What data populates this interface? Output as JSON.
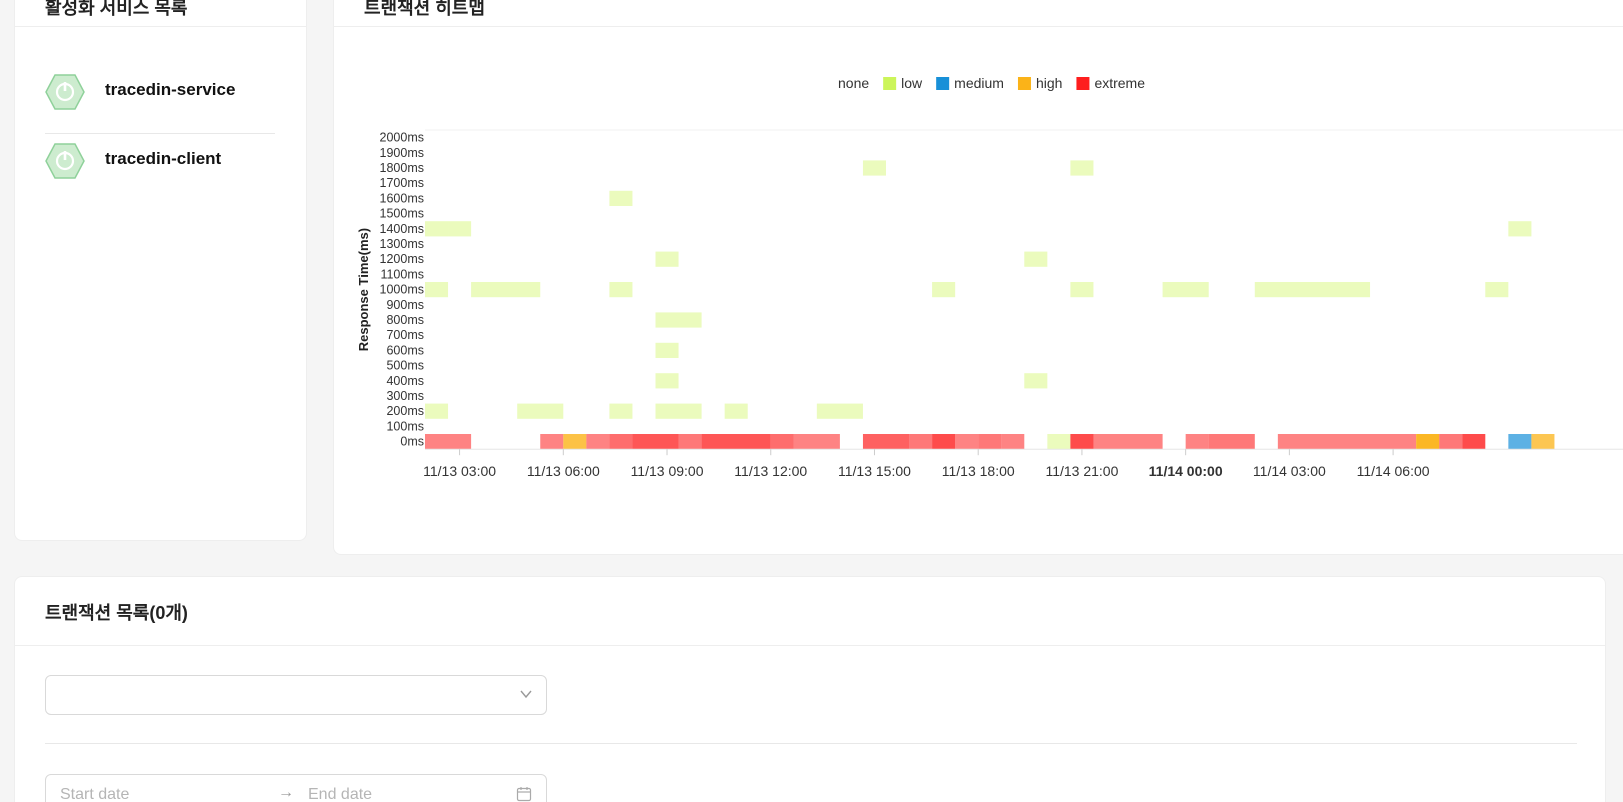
{
  "services_card": {
    "title": "활성화 서비스 목록",
    "items": [
      {
        "name": "tracedin-service",
        "icon": "power-hex-icon"
      },
      {
        "name": "tracedin-client",
        "icon": "power-hex-icon"
      }
    ]
  },
  "heatmap_card": {
    "title": "트랜잭션 히트맵"
  },
  "transactions_card": {
    "title": "트랜잭션 목록(0개)",
    "select": {
      "value": ""
    },
    "date_range": {
      "start_placeholder": "Start date",
      "end_placeholder": "End date",
      "separator": "→"
    }
  },
  "colors": {
    "low": "#ccf55a",
    "medium": "#1890d8",
    "high": "#fbb318",
    "extreme": "#fe1e1e"
  },
  "chart_data": {
    "type": "heatmap",
    "ylabel": "Response Time(ms)",
    "legend": [
      "none",
      "low",
      "medium",
      "high",
      "extreme"
    ],
    "legend_position": "top",
    "y_categories": [
      "0ms",
      "100ms",
      "200ms",
      "300ms",
      "400ms",
      "500ms",
      "600ms",
      "700ms",
      "800ms",
      "900ms",
      "1000ms",
      "1100ms",
      "1200ms",
      "1300ms",
      "1400ms",
      "1500ms",
      "1600ms",
      "1700ms",
      "1800ms",
      "1900ms",
      "2000ms"
    ],
    "x_ticks": [
      {
        "label": "11/13 03:00",
        "bold": false
      },
      {
        "label": "11/13 06:00",
        "bold": false
      },
      {
        "label": "11/13 09:00",
        "bold": false
      },
      {
        "label": "11/13 12:00",
        "bold": false
      },
      {
        "label": "11/13 15:00",
        "bold": false
      },
      {
        "label": "11/13 18:00",
        "bold": false
      },
      {
        "label": "11/13 21:00",
        "bold": false
      },
      {
        "label": "11/14 00:00",
        "bold": true
      },
      {
        "label": "11/14 03:00",
        "bold": false
      },
      {
        "label": "11/14 06:00",
        "bold": false
      }
    ],
    "x_start": "11/13 02:00",
    "bin_minutes": 40,
    "cells": [
      {
        "x_bin": 0,
        "w": 1,
        "y": "1400ms",
        "level": "low",
        "alpha": 0.4
      },
      {
        "x_bin": 1,
        "w": 1,
        "y": "1400ms",
        "level": "low",
        "alpha": 0.4
      },
      {
        "x_bin": 0,
        "w": 1,
        "y": "1000ms",
        "level": "low",
        "alpha": 0.4
      },
      {
        "x_bin": 2,
        "w": 3,
        "y": "1000ms",
        "level": "low",
        "alpha": 0.4
      },
      {
        "x_bin": 0,
        "w": 1,
        "y": "200ms",
        "level": "low",
        "alpha": 0.4
      },
      {
        "x_bin": 4,
        "w": 2,
        "y": "200ms",
        "level": "low",
        "alpha": 0.4
      },
      {
        "x_bin": 8,
        "w": 1,
        "y": "1600ms",
        "level": "low",
        "alpha": 0.4
      },
      {
        "x_bin": 8,
        "w": 1,
        "y": "1000ms",
        "level": "low",
        "alpha": 0.4
      },
      {
        "x_bin": 8,
        "w": 1,
        "y": "200ms",
        "level": "low",
        "alpha": 0.4
      },
      {
        "x_bin": 10,
        "w": 1,
        "y": "1200ms",
        "level": "low",
        "alpha": 0.4
      },
      {
        "x_bin": 10,
        "w": 2,
        "y": "800ms",
        "level": "low",
        "alpha": 0.4
      },
      {
        "x_bin": 10,
        "w": 1,
        "y": "600ms",
        "level": "low",
        "alpha": 0.4
      },
      {
        "x_bin": 10,
        "w": 1,
        "y": "400ms",
        "level": "low",
        "alpha": 0.4
      },
      {
        "x_bin": 10,
        "w": 2,
        "y": "200ms",
        "level": "low",
        "alpha": 0.4
      },
      {
        "x_bin": 13,
        "w": 1,
        "y": "200ms",
        "level": "low",
        "alpha": 0.4
      },
      {
        "x_bin": 17,
        "w": 2,
        "y": "200ms",
        "level": "low",
        "alpha": 0.4
      },
      {
        "x_bin": 19,
        "w": 1,
        "y": "1800ms",
        "level": "low",
        "alpha": 0.4
      },
      {
        "x_bin": 22,
        "w": 1,
        "y": "1000ms",
        "level": "low",
        "alpha": 0.4
      },
      {
        "x_bin": 26,
        "w": 1,
        "y": "1200ms",
        "level": "low",
        "alpha": 0.4
      },
      {
        "x_bin": 26,
        "w": 1,
        "y": "400ms",
        "level": "low",
        "alpha": 0.4
      },
      {
        "x_bin": 28,
        "w": 1,
        "y": "1800ms",
        "level": "low",
        "alpha": 0.4
      },
      {
        "x_bin": 28,
        "w": 1,
        "y": "1000ms",
        "level": "low",
        "alpha": 0.4
      },
      {
        "x_bin": 32,
        "w": 2,
        "y": "1000ms",
        "level": "low",
        "alpha": 0.4
      },
      {
        "x_bin": 36,
        "w": 5,
        "y": "1000ms",
        "level": "low",
        "alpha": 0.4
      },
      {
        "x_bin": 46,
        "w": 1,
        "y": "1000ms",
        "level": "low",
        "alpha": 0.4
      },
      {
        "x_bin": 47,
        "w": 1,
        "y": "1400ms",
        "level": "low",
        "alpha": 0.4
      },
      {
        "x_bin": 0,
        "w": 2,
        "y": "0ms",
        "level": "extreme",
        "alpha": 0.55
      },
      {
        "x_bin": 5,
        "w": 1,
        "y": "0ms",
        "level": "extreme",
        "alpha": 0.55
      },
      {
        "x_bin": 6,
        "w": 1,
        "y": "0ms",
        "level": "high",
        "alpha": 0.8
      },
      {
        "x_bin": 7,
        "w": 1,
        "y": "0ms",
        "level": "extreme",
        "alpha": 0.55
      },
      {
        "x_bin": 8,
        "w": 1,
        "y": "0ms",
        "level": "extreme",
        "alpha": 0.65
      },
      {
        "x_bin": 9,
        "w": 2,
        "y": "0ms",
        "level": "extreme",
        "alpha": 0.75
      },
      {
        "x_bin": 11,
        "w": 1,
        "y": "0ms",
        "level": "extreme",
        "alpha": 0.6
      },
      {
        "x_bin": 12,
        "w": 3,
        "y": "0ms",
        "level": "extreme",
        "alpha": 0.75
      },
      {
        "x_bin": 15,
        "w": 1,
        "y": "0ms",
        "level": "extreme",
        "alpha": 0.65
      },
      {
        "x_bin": 16,
        "w": 2,
        "y": "0ms",
        "level": "extreme",
        "alpha": 0.55
      },
      {
        "x_bin": 19,
        "w": 2,
        "y": "0ms",
        "level": "extreme",
        "alpha": 0.7
      },
      {
        "x_bin": 21,
        "w": 1,
        "y": "0ms",
        "level": "extreme",
        "alpha": 0.6
      },
      {
        "x_bin": 22,
        "w": 1,
        "y": "0ms",
        "level": "extreme",
        "alpha": 0.8
      },
      {
        "x_bin": 23,
        "w": 1,
        "y": "0ms",
        "level": "extreme",
        "alpha": 0.55
      },
      {
        "x_bin": 24,
        "w": 1,
        "y": "0ms",
        "level": "extreme",
        "alpha": 0.6
      },
      {
        "x_bin": 25,
        "w": 1,
        "y": "0ms",
        "level": "extreme",
        "alpha": 0.55
      },
      {
        "x_bin": 27,
        "w": 1,
        "y": "0ms",
        "level": "low",
        "alpha": 0.4
      },
      {
        "x_bin": 28,
        "w": 1,
        "y": "0ms",
        "level": "extreme",
        "alpha": 0.8
      },
      {
        "x_bin": 29,
        "w": 3,
        "y": "0ms",
        "level": "extreme",
        "alpha": 0.55
      },
      {
        "x_bin": 33,
        "w": 1,
        "y": "0ms",
        "level": "extreme",
        "alpha": 0.55
      },
      {
        "x_bin": 34,
        "w": 2,
        "y": "0ms",
        "level": "extreme",
        "alpha": 0.6
      },
      {
        "x_bin": 37,
        "w": 6,
        "y": "0ms",
        "level": "extreme",
        "alpha": 0.55
      },
      {
        "x_bin": 43,
        "w": 1,
        "y": "0ms",
        "level": "high",
        "alpha": 0.95
      },
      {
        "x_bin": 44,
        "w": 1,
        "y": "0ms",
        "level": "extreme",
        "alpha": 0.6
      },
      {
        "x_bin": 45,
        "w": 1,
        "y": "0ms",
        "level": "extreme",
        "alpha": 0.8
      },
      {
        "x_bin": 47,
        "w": 1,
        "y": "0ms",
        "level": "medium",
        "alpha": 0.7
      },
      {
        "x_bin": 48,
        "w": 1,
        "y": "0ms",
        "level": "high",
        "alpha": 0.75
      }
    ]
  }
}
